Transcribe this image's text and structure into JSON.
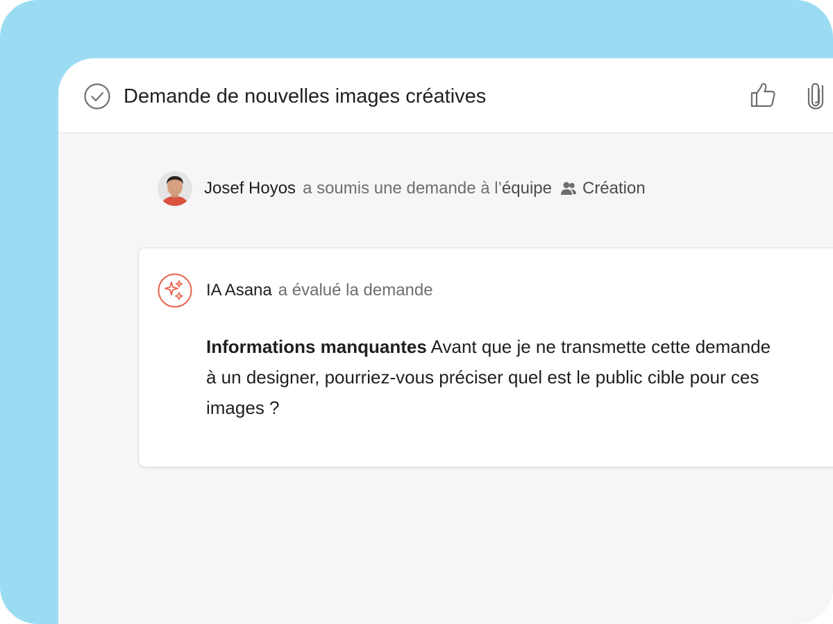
{
  "task": {
    "title": "Demande de nouvelles images créatives"
  },
  "toolbar": {
    "icons": [
      "check-circle-icon",
      "thumbs-up-icon",
      "paperclip-icon"
    ]
  },
  "activity": {
    "actor": "Josef Hoyos",
    "action": "a soumis une demande à l’",
    "team_word": "équipe",
    "team_icon": "team-icon",
    "team_name": "Création"
  },
  "ai_comment": {
    "author": "IA Asana",
    "action": "a évalué la demande",
    "label": "Informations manquantes",
    "message": "Avant que je ne transmette cette demande à un designer, pourriez-vous préciser quel est le public cible pour ces images ?"
  },
  "colors": {
    "backdrop": "#9cdcf3",
    "ai_accent": "#e8604c",
    "text_primary": "#1e1f21",
    "text_secondary": "#6d6e6f"
  }
}
